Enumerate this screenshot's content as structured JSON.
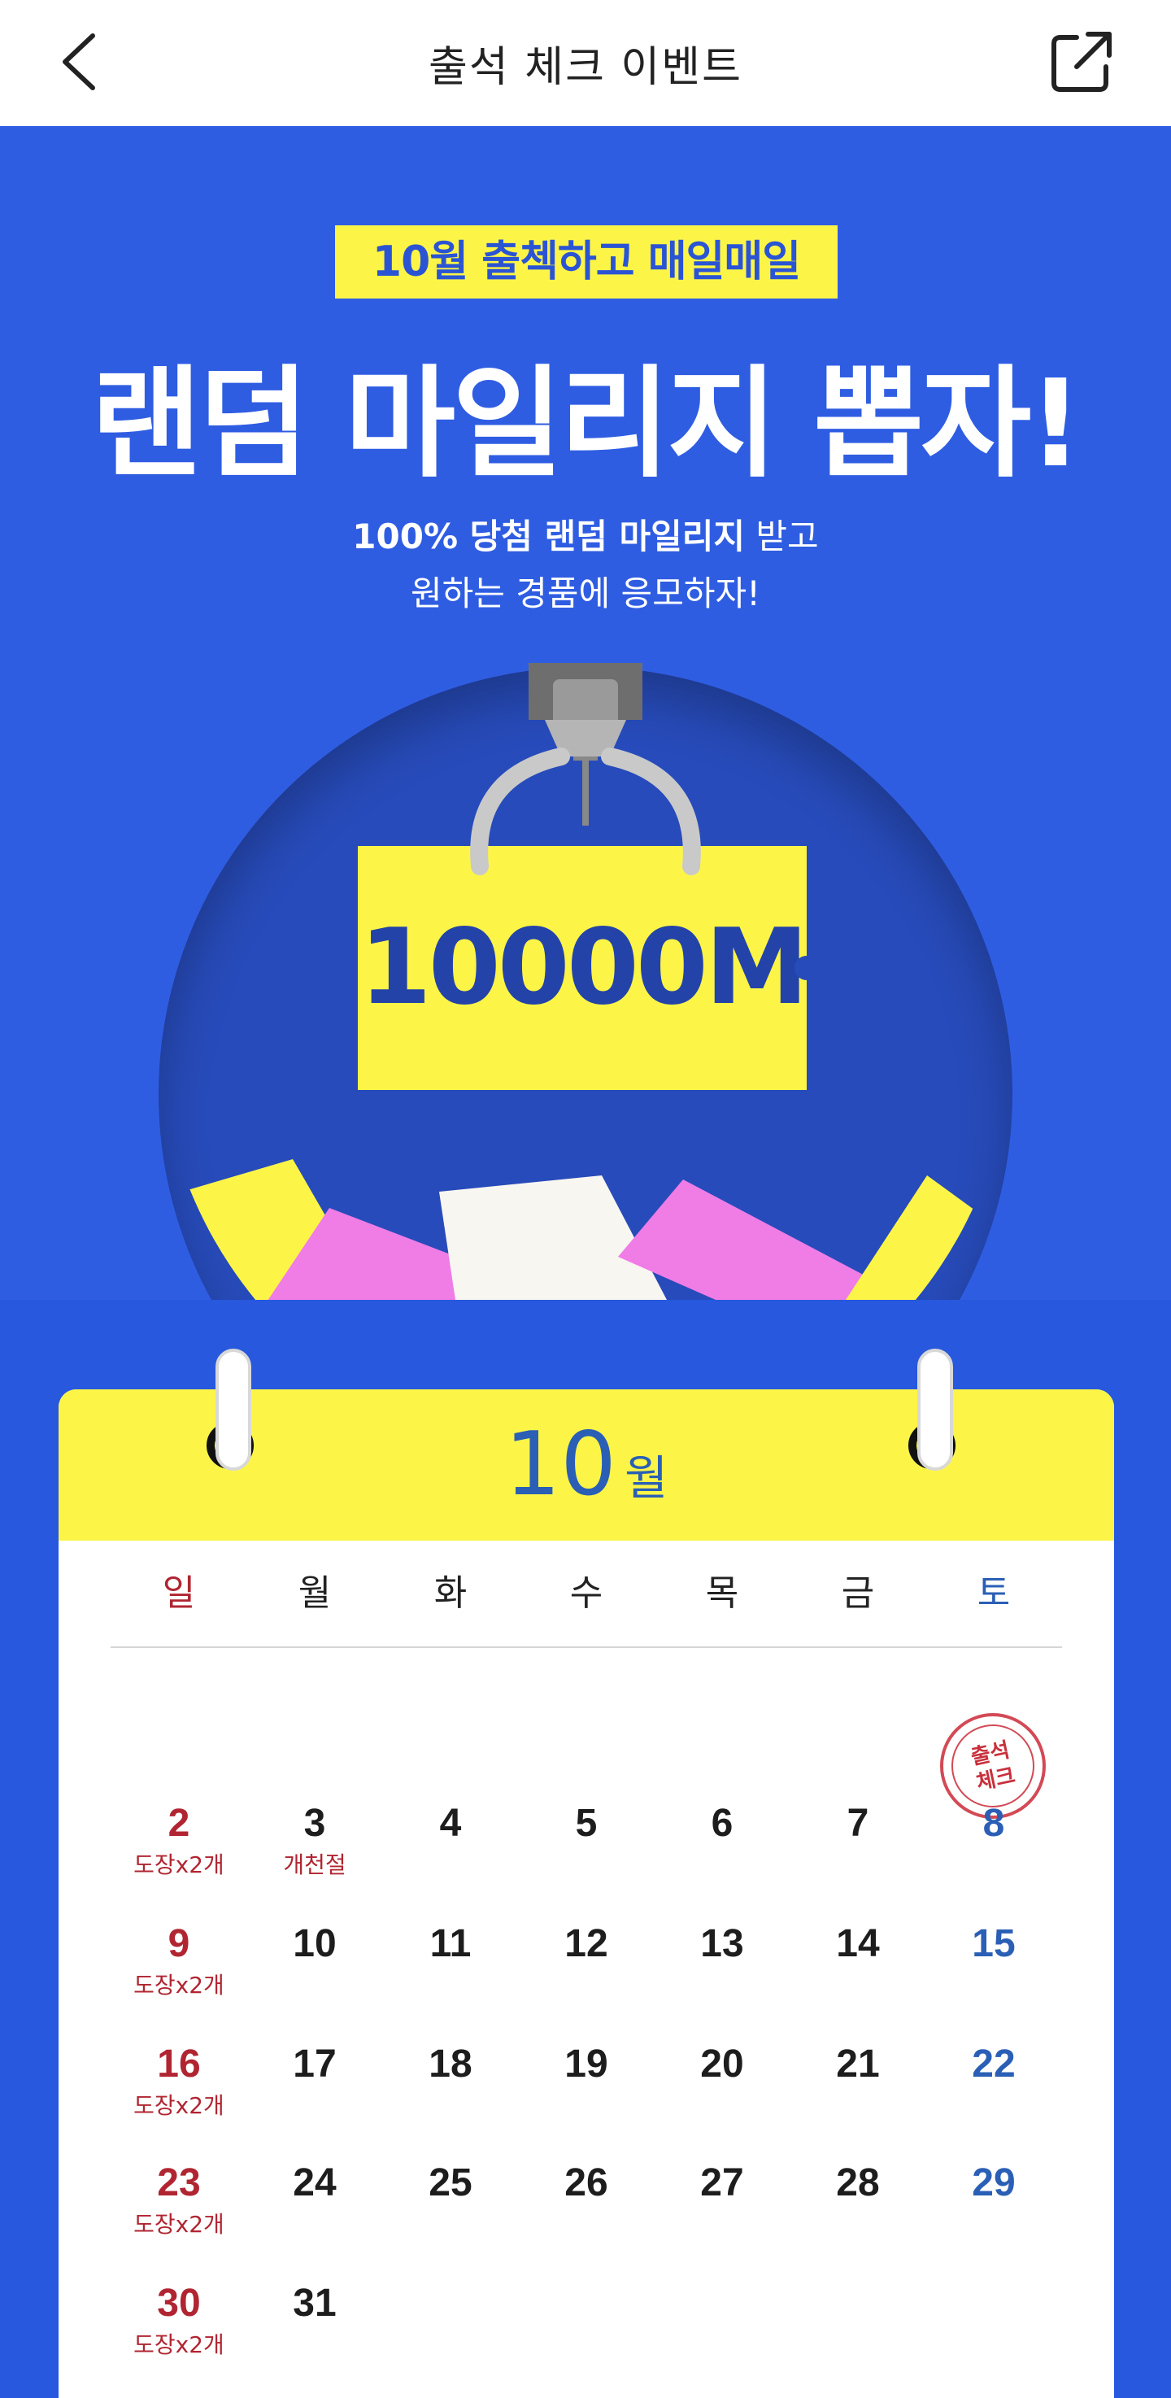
{
  "header": {
    "title": "출석 체크 이벤트",
    "back_icon": "chevron-left-icon",
    "share_icon": "share-external-icon"
  },
  "banner": {
    "tag": "10월 출첵하고 매일매일",
    "title": "랜덤 마일리지 뽑자!",
    "sub_bold": "100% 당첨 랜덤 마일리지",
    "sub_normal": " 받고",
    "sub_line2": "원하는 경품에 응모하자!",
    "ticket_amount": "10000M",
    "colors": {
      "background": "#2f5de2",
      "accent_yellow": "#fcf548",
      "pink": "#f07ce6"
    }
  },
  "calendar": {
    "month_number": "10",
    "month_unit": "월",
    "weekdays": [
      "일",
      "월",
      "화",
      "수",
      "목",
      "금",
      "토"
    ],
    "stamp_text_line1": "출석",
    "stamp_text_line2": "체크",
    "rows": [
      [
        {
          "n": "2",
          "note": "도장x2개"
        },
        {
          "n": "3",
          "note": "개천절"
        },
        {
          "n": "4",
          "note": ""
        },
        {
          "n": "5",
          "note": ""
        },
        {
          "n": "6",
          "note": ""
        },
        {
          "n": "7",
          "note": ""
        },
        {
          "n": "8",
          "note": ""
        }
      ],
      [
        {
          "n": "9",
          "note": "도장x2개"
        },
        {
          "n": "10",
          "note": ""
        },
        {
          "n": "11",
          "note": ""
        },
        {
          "n": "12",
          "note": ""
        },
        {
          "n": "13",
          "note": ""
        },
        {
          "n": "14",
          "note": ""
        },
        {
          "n": "15",
          "note": ""
        }
      ],
      [
        {
          "n": "16",
          "note": "도장x2개"
        },
        {
          "n": "17",
          "note": ""
        },
        {
          "n": "18",
          "note": ""
        },
        {
          "n": "19",
          "note": ""
        },
        {
          "n": "20",
          "note": ""
        },
        {
          "n": "21",
          "note": ""
        },
        {
          "n": "22",
          "note": ""
        }
      ],
      [
        {
          "n": "23",
          "note": "도장x2개"
        },
        {
          "n": "24",
          "note": ""
        },
        {
          "n": "25",
          "note": ""
        },
        {
          "n": "26",
          "note": ""
        },
        {
          "n": "27",
          "note": ""
        },
        {
          "n": "28",
          "note": ""
        },
        {
          "n": "29",
          "note": ""
        }
      ],
      [
        {
          "n": "30",
          "note": "도장x2개"
        },
        {
          "n": "31",
          "note": ""
        }
      ]
    ],
    "colors": {
      "sunday": "#b02531",
      "saturday": "#2a5fb5",
      "header_bg": "#fcf548"
    }
  }
}
